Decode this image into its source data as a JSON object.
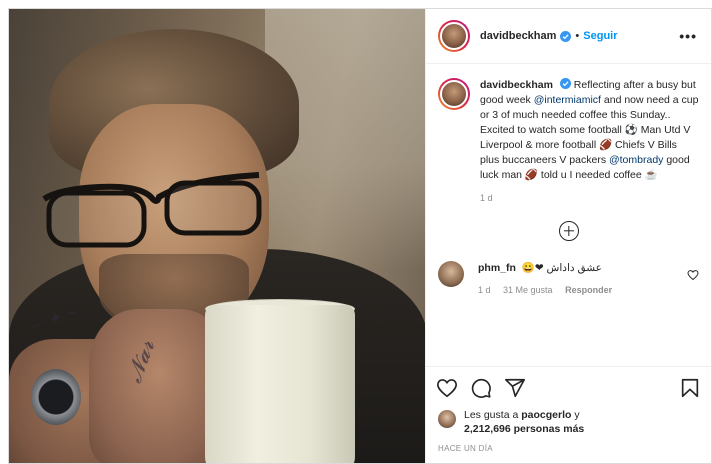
{
  "post": {
    "author": {
      "username": "davidbeckham",
      "verified": true
    },
    "header": {
      "separator": "•",
      "follow_label": "Seguir",
      "more_label": "•••"
    },
    "caption": {
      "username": "davidbeckham",
      "segments": [
        " Reflecting after a busy but good week ",
        "@intermiamicf",
        " and now need a cup or 3 of much needed coffee this Sunday.. Excited to watch some football ⚽ Man Utd V Liverpool & more football 🏈 Chiefs V Bills plus buccaneers V packers ",
        "@tombrady",
        " good luck man 🏈 told u I needed coffee ☕"
      ],
      "age": "1 d"
    },
    "comments": [
      {
        "username": "phm_fn",
        "text": "عشق داداش ❤😀",
        "age": "1 d",
        "likes": "31 Me gusta",
        "reply_label": "Responder"
      }
    ],
    "likes": {
      "prefix": "Les gusta a ",
      "liker": "paocgerlo",
      "connector": " y",
      "count": "2,212,696 personas más"
    },
    "timestamp": "HACE UN DÍA"
  },
  "icons": {
    "verified": "verified-badge-icon",
    "load_more": "plus-circle-icon",
    "like": "heart-icon",
    "comment": "comment-icon",
    "share": "share-icon",
    "save": "bookmark-icon"
  },
  "colors": {
    "accent": "#0095f6",
    "border": "#dbdbdb",
    "muted": "#8e8e8e",
    "text": "#262626"
  }
}
